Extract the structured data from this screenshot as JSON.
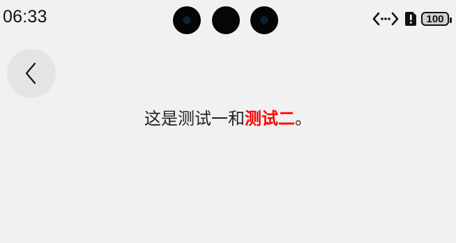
{
  "status_bar": {
    "time": "06:33",
    "battery_level": "100",
    "icons": [
      "camera-icon",
      "camera-icon",
      "camera-icon",
      "network-icon",
      "alert-icon",
      "battery-icon"
    ]
  },
  "nav": {
    "back_icon": "chevron-left-icon"
  },
  "content": {
    "sentence_prefix": "这是测试一和",
    "sentence_highlight": "测试二",
    "sentence_suffix": "。",
    "highlight_color": "#ff0000"
  }
}
